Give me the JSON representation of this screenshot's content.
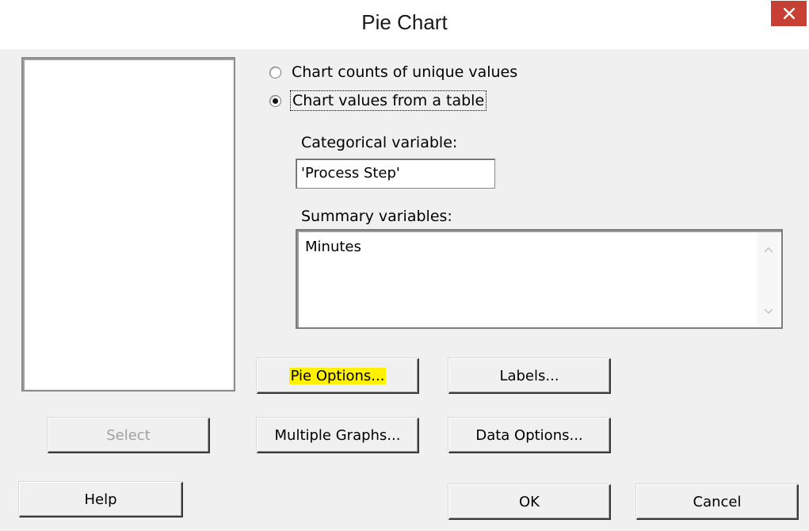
{
  "window": {
    "title": "Pie Chart",
    "close_glyph": "✕",
    "close_color": "#c84034"
  },
  "source_list": {
    "items": []
  },
  "radio_options": [
    {
      "label": "Chart counts of unique values",
      "checked": false
    },
    {
      "label": "Chart values from a table",
      "checked": true
    }
  ],
  "categorical": {
    "label": "Categorical variable:",
    "value": "'Process Step'"
  },
  "summary": {
    "label": "Summary variables:",
    "value": "Minutes"
  },
  "buttons": {
    "select": "Select",
    "pie_options": "Pie Options...",
    "labels": "Labels...",
    "multiple_graphs": "Multiple Graphs...",
    "data_options": "Data Options...",
    "help": "Help",
    "ok": "OK",
    "cancel": "Cancel"
  },
  "highlight_color": "#fff200"
}
